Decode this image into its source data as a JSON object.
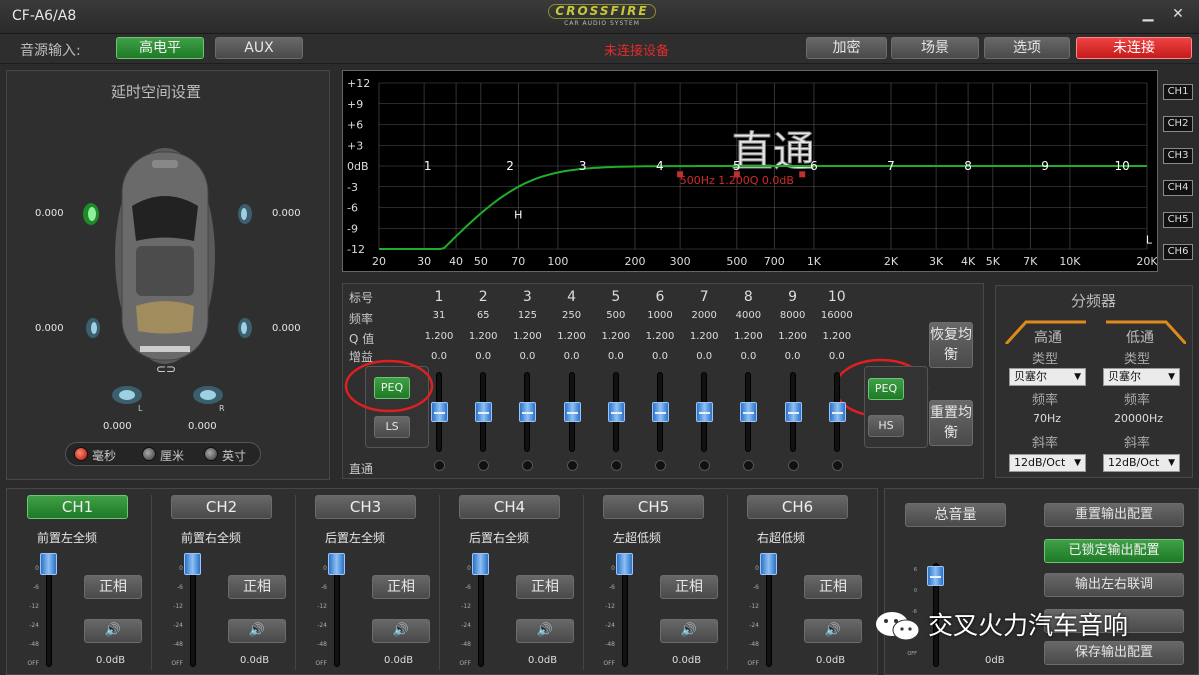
{
  "window": {
    "title": "CF-A6/A8",
    "logo_main": "CROSSFIRE",
    "logo_sub": "CAR AUDIO SYSTEM",
    "min_label": "▁",
    "close_label": "✕"
  },
  "toolbar": {
    "source_label": "音源输入:",
    "source_high": "高电平",
    "source_aux": "AUX",
    "status": "未连接设备",
    "encrypt": "加密",
    "scene": "场景",
    "options": "选项",
    "connection": "未连接"
  },
  "delay": {
    "title": "延时空间设置",
    "fl": "0.000",
    "fr": "0.000",
    "rl": "0.000",
    "rr": "0.000",
    "subl": "0.000",
    "subr": "0.000",
    "link_icon": "⊂⊃",
    "units": {
      "ms": "毫秒",
      "cm": "厘米",
      "inch": "英寸"
    }
  },
  "graph": {
    "ylabels": [
      "+12",
      "+9",
      "+6",
      "+3",
      "0dB",
      "-3",
      "-6",
      "-9",
      "-12"
    ],
    "xlabels": [
      "20",
      "30",
      "40",
      "50",
      "70",
      "100",
      "200",
      "300",
      "500",
      "700",
      "1K",
      "2K",
      "3K",
      "4K",
      "5K",
      "7K",
      "10K",
      "20K"
    ],
    "band_labels": [
      "1",
      "2",
      "3",
      "4",
      "5",
      "6",
      "7",
      "8",
      "9",
      "10"
    ],
    "watermark": "直通",
    "readout": "500Hz 1.200Q 0.0dB",
    "h_label": "H",
    "l_label": "L",
    "channels": [
      "CH1",
      "CH2",
      "CH3",
      "CH4",
      "CH5",
      "CH6"
    ]
  },
  "eq": {
    "row_labels": {
      "index": "标号",
      "freq": "频率",
      "q": "Q 值",
      "gain": "增益",
      "bypass": "直通"
    },
    "bands": [
      {
        "n": "1",
        "f": "31",
        "q": "1.200",
        "g": "0.0"
      },
      {
        "n": "2",
        "f": "65",
        "q": "1.200",
        "g": "0.0"
      },
      {
        "n": "3",
        "f": "125",
        "q": "1.200",
        "g": "0.0"
      },
      {
        "n": "4",
        "f": "250",
        "q": "1.200",
        "g": "0.0"
      },
      {
        "n": "5",
        "f": "500",
        "q": "1.200",
        "g": "0.0"
      },
      {
        "n": "6",
        "f": "1000",
        "q": "1.200",
        "g": "0.0"
      },
      {
        "n": "7",
        "f": "2000",
        "q": "1.200",
        "g": "0.0"
      },
      {
        "n": "8",
        "f": "4000",
        "q": "1.200",
        "g": "0.0"
      },
      {
        "n": "9",
        "f": "8000",
        "q": "1.200",
        "g": "0.0"
      },
      {
        "n": "10",
        "f": "16000",
        "q": "1.200",
        "g": "0.0"
      }
    ],
    "peq_left": "PEQ",
    "ls": "LS",
    "peq_right": "PEQ",
    "hs": "HS",
    "restore_eq": "恢复均衡",
    "reset_eq": "重置均衡"
  },
  "crossover": {
    "title": "分频器",
    "high": {
      "label": "高通",
      "type_label": "类型",
      "type": "贝塞尔",
      "freq_label": "频率",
      "freq": "70Hz",
      "slope_label": "斜率",
      "slope": "12dB/Oct"
    },
    "low": {
      "label": "低通",
      "type_label": "类型",
      "type": "贝塞尔",
      "freq_label": "频率",
      "freq": "20000Hz",
      "slope_label": "斜率",
      "slope": "12dB/Oct"
    }
  },
  "channels": [
    {
      "tab": "CH1",
      "name": "前置左全频",
      "phase": "正相",
      "level": "0.0dB"
    },
    {
      "tab": "CH2",
      "name": "前置右全频",
      "phase": "正相",
      "level": "0.0dB"
    },
    {
      "tab": "CH3",
      "name": "后置左全频",
      "phase": "正相",
      "level": "0.0dB"
    },
    {
      "tab": "CH4",
      "name": "后置右全频",
      "phase": "正相",
      "level": "0.0dB"
    },
    {
      "tab": "CH5",
      "name": "左超低频",
      "phase": "正相",
      "level": "0.0dB"
    },
    {
      "tab": "CH6",
      "name": "右超低频",
      "phase": "正相",
      "level": "0.0dB"
    }
  ],
  "scale_labels": [
    "0",
    "-6",
    "-12",
    "-24",
    "-48",
    "OFF"
  ],
  "master": {
    "label": "总音量",
    "level": "0dB",
    "scale": [
      "6",
      "0",
      "-6",
      "-12",
      "OFF"
    ]
  },
  "output_buttons": {
    "reset": "重置输出配置",
    "locked": "已锁定输出配置",
    "link": "输出左右联调",
    "save": "保存输出配置"
  },
  "watermark_text": "交叉火力汽车音响",
  "colors": {
    "accent_green": "#1e7a26",
    "alert_red": "#d92727",
    "curve": "#1fae2a"
  }
}
